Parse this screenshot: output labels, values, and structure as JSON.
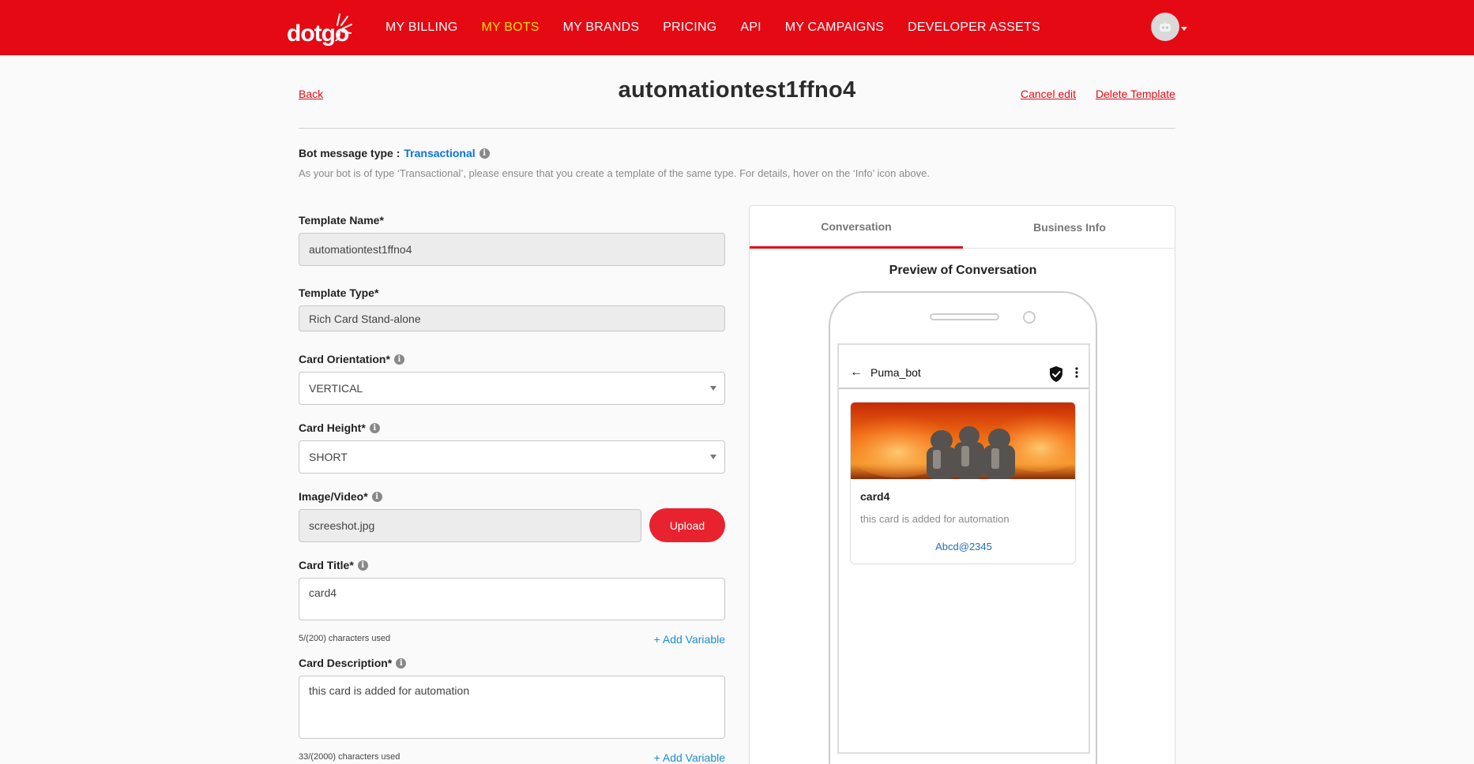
{
  "nav": {
    "logo_text": "dotgo",
    "items": [
      "MY BILLING",
      "MY BOTS",
      "MY BRANDS",
      "PRICING",
      "API",
      "MY CAMPAIGNS",
      "DEVELOPER ASSETS"
    ],
    "active_index": 1
  },
  "header": {
    "back_label": "Back",
    "title": "automationtest1ffno4",
    "cancel_label": "Cancel edit",
    "delete_label": "Delete Template"
  },
  "bot_message": {
    "label": "Bot message type :",
    "type": "Transactional",
    "note": "As your bot is of type ‘Transactional’, please ensure that you create a template of the same type. For details, hover on the ‘Info’ icon above."
  },
  "form": {
    "template_name_label": "Template Name*",
    "template_name_value": "automationtest1ffno4",
    "template_type_label": "Template Type*",
    "template_type_value": "Rich Card Stand-alone",
    "orientation_label": "Card Orientation*",
    "orientation_value": "VERTICAL",
    "height_label": "Card Height*",
    "height_value": "SHORT",
    "media_label": "Image/Video*",
    "media_value": "screeshot.jpg",
    "upload_label": "Upload",
    "card_title_label": "Card Title*",
    "card_title_value": "card4",
    "card_title_counter": "5/(200) characters used",
    "add_variable_label": "+ Add Variable",
    "card_desc_label": "Card Description*",
    "card_desc_value": "this card is added for automation",
    "card_desc_counter": "33/(2000) characters used"
  },
  "preview": {
    "tabs": [
      "Conversation",
      "Business Info"
    ],
    "active_tab": 0,
    "title": "Preview of Conversation",
    "bot_name": "Puma_bot",
    "card": {
      "title": "card4",
      "description": "this card is added for automation",
      "action": "Abcd@2345"
    }
  },
  "icons": {
    "info": "info-icon",
    "back_arrow": "arrow-left-icon",
    "verified": "shield-check-icon",
    "more": "more-vertical-icon",
    "avatar": "robot-avatar-icon"
  },
  "colors": {
    "brand_red": "#e50914",
    "nav_active": "#ffe000",
    "link_blue": "#1a8fd0",
    "transactional_blue": "#0a74da"
  }
}
